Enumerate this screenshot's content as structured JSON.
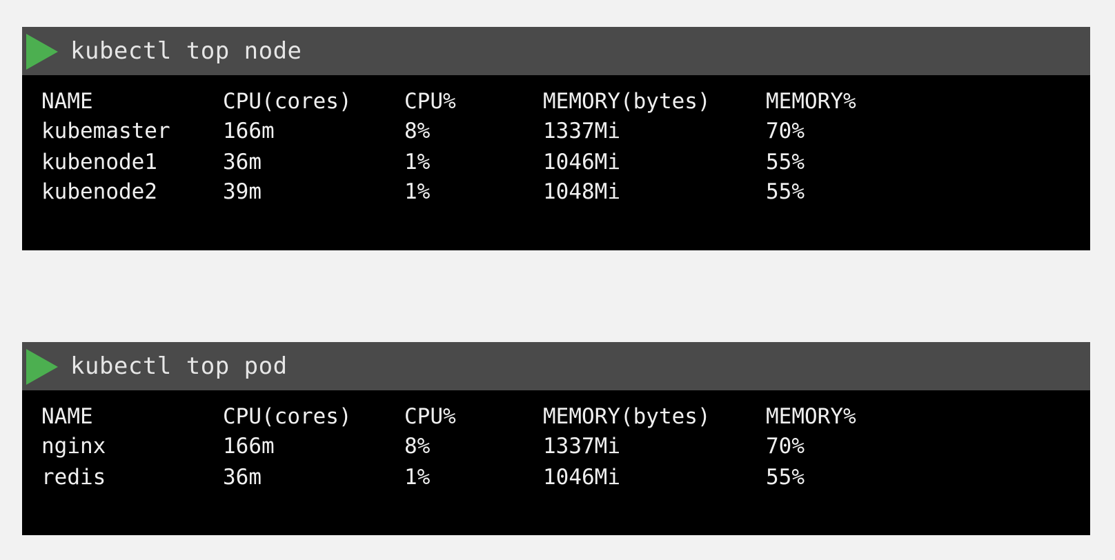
{
  "colors": {
    "background": "#f2f2f2",
    "command_bar": "#4a4a4a",
    "terminal": "#000000",
    "play_icon": "#4caf50",
    "text": "#f0f0f0"
  },
  "node_panel": {
    "command": "kubectl top node",
    "columns": [
      "NAME",
      "CPU(cores)",
      "CPU%",
      "MEMORY(bytes)",
      "MEMORY%"
    ],
    "rows": [
      [
        "kubemaster",
        "166m",
        "8%",
        "1337Mi",
        "70%"
      ],
      [
        "kubenode1",
        "36m",
        "1%",
        "1046Mi",
        "55%"
      ],
      [
        "kubenode2",
        "39m",
        "1%",
        "1048Mi",
        "55%"
      ]
    ]
  },
  "pod_panel": {
    "command": "kubectl top pod",
    "columns": [
      "NAME",
      "CPU(cores)",
      "CPU%",
      "MEMORY(bytes)",
      "MEMORY%"
    ],
    "rows": [
      [
        "nginx",
        "166m",
        "8%",
        "1337Mi",
        "70%"
      ],
      [
        "redis",
        "36m",
        "1%",
        "1046Mi",
        "55%"
      ]
    ]
  }
}
